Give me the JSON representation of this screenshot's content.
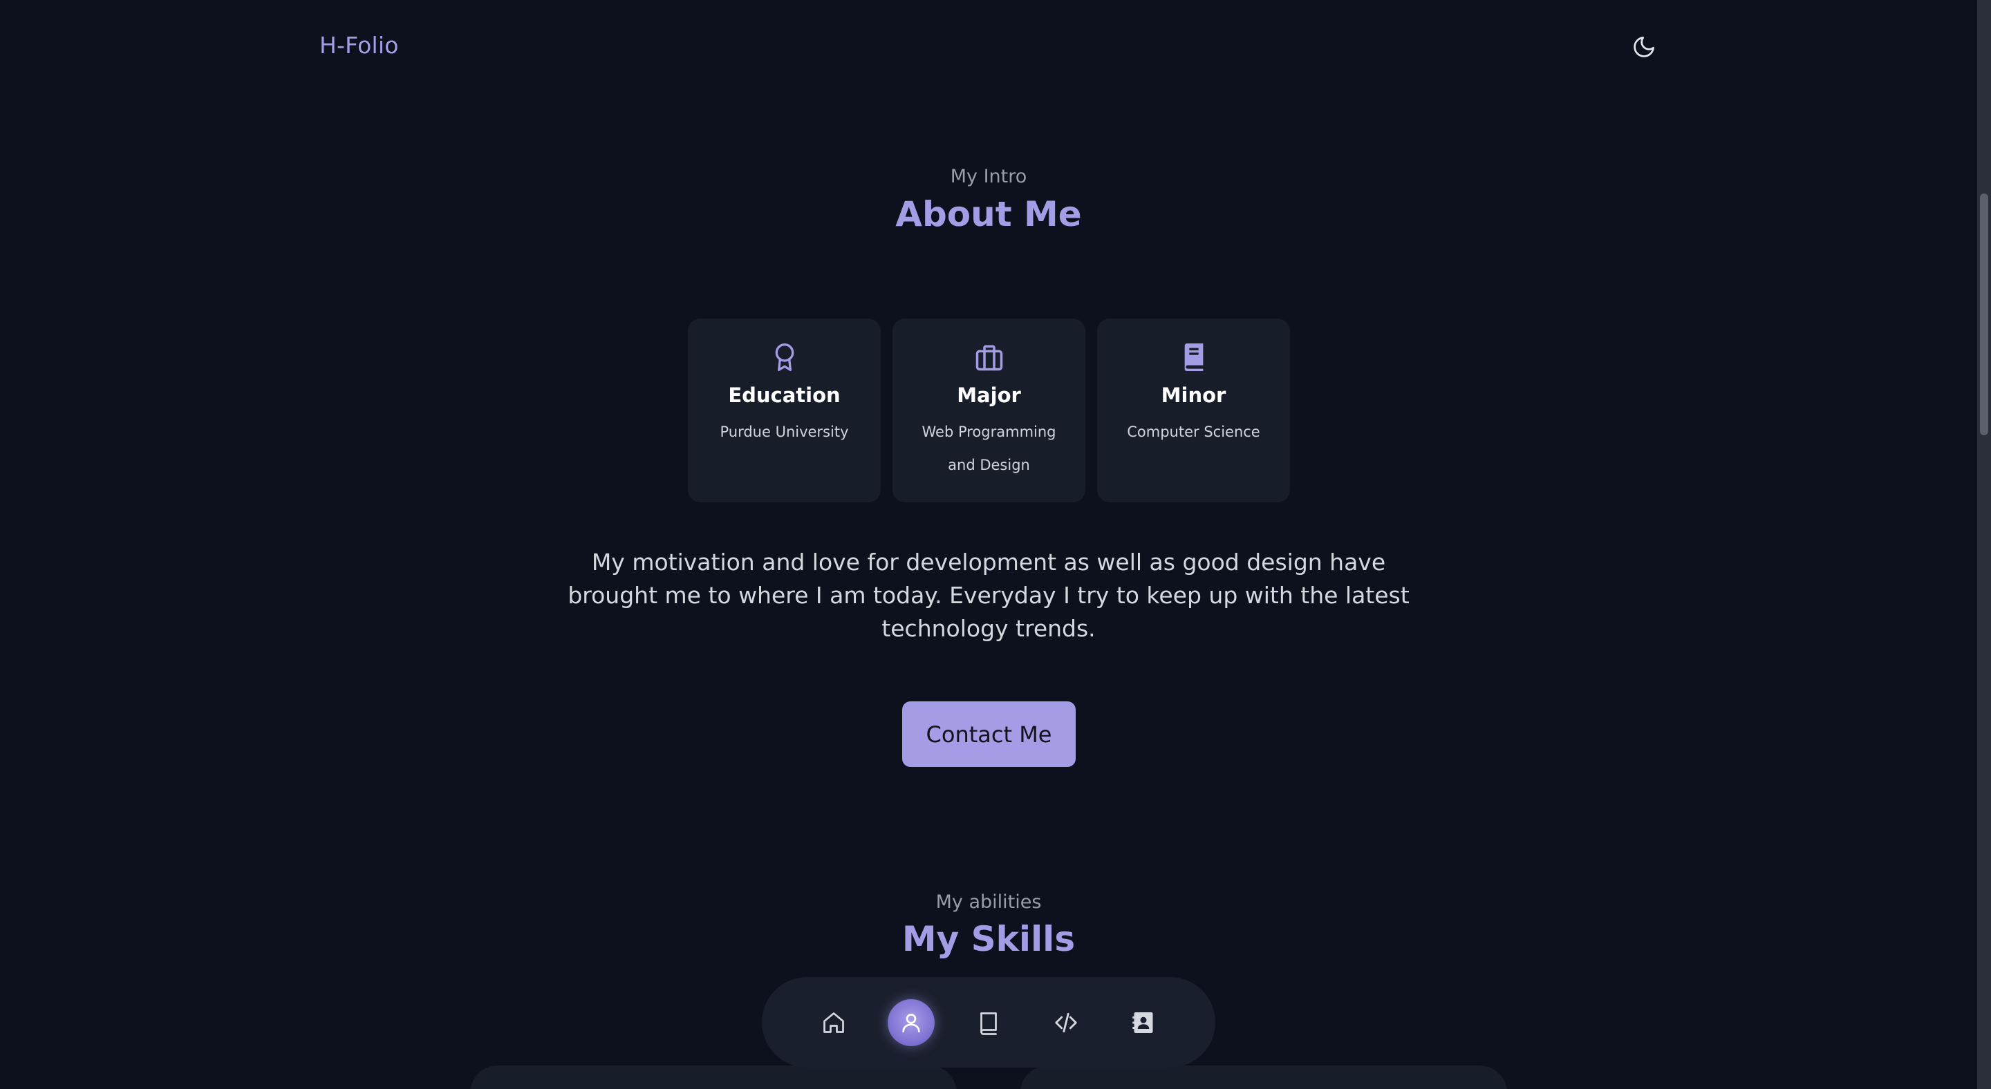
{
  "header": {
    "logo": "H-Folio",
    "theme_icon": "moon-icon"
  },
  "about": {
    "subtitle": "My Intro",
    "title": "About Me",
    "cards": [
      {
        "icon": "award-icon",
        "title": "Education",
        "subtitle": "Purdue University"
      },
      {
        "icon": "briefcase-icon",
        "title": "Major",
        "subtitle": "Web Programming and Design"
      },
      {
        "icon": "book-icon",
        "title": "Minor",
        "subtitle": "Computer Science"
      }
    ],
    "description": "My motivation and love for development as well as good design have brought me to where I am today. Everyday I try to keep up with the latest technology trends.",
    "contact_button": "Contact Me"
  },
  "skills": {
    "subtitle": "My abilities",
    "title": "My Skills"
  },
  "bottom_nav": {
    "items": [
      {
        "icon": "home-icon",
        "active": false
      },
      {
        "icon": "user-icon",
        "active": true
      },
      {
        "icon": "book-icon",
        "active": false
      },
      {
        "icon": "code-icon",
        "active": false
      },
      {
        "icon": "contact-card-icon",
        "active": false
      }
    ]
  },
  "colors": {
    "background": "#0c111d",
    "accent": "#a59ce6",
    "card": "#181d2a"
  }
}
